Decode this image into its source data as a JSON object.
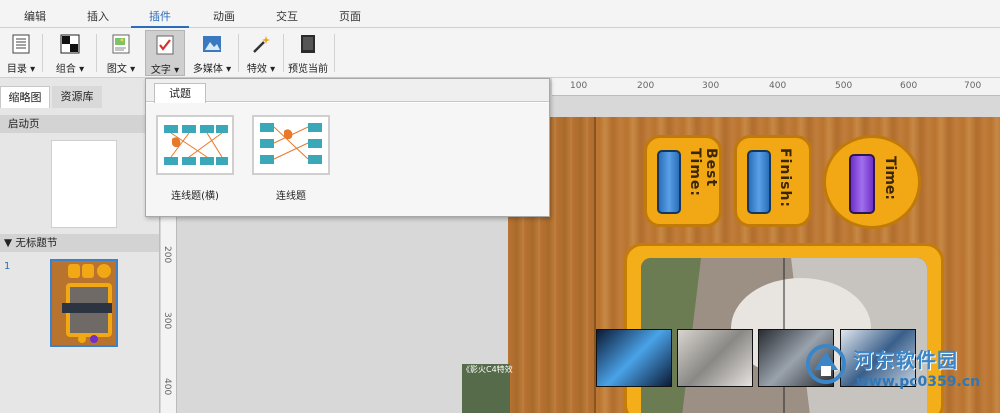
{
  "menu": {
    "tabs": [
      "编辑",
      "插入",
      "插件",
      "动画",
      "交互",
      "页面"
    ],
    "active_tab": "插件"
  },
  "toolbar": {
    "items": [
      {
        "label": "目录 ▾",
        "icon": "toc-icon"
      },
      {
        "label": "组合 ▾",
        "icon": "group-icon"
      },
      {
        "label": "图文 ▾",
        "icon": "image-text-icon"
      },
      {
        "label": "文字 ▾",
        "icon": "text-quiz-icon"
      },
      {
        "label": "多媒体 ▾",
        "icon": "multimedia-icon"
      },
      {
        "label": "特效 ▾",
        "icon": "effects-icon"
      },
      {
        "label": "预览当前",
        "icon": "preview-icon"
      }
    ]
  },
  "left_panel": {
    "tabs": [
      "缩略图",
      "资源库"
    ],
    "active_tab": "缩略图",
    "start_page_label": "启动页",
    "section_label": "▼ 无标题节",
    "slide_number": "1"
  },
  "ruler": {
    "h_ticks": [
      "100",
      "200",
      "300",
      "400",
      "500",
      "600",
      "700"
    ],
    "v_ticks": [
      "200",
      "300",
      "400"
    ]
  },
  "slide": {
    "badge_best_time": "Best Time:",
    "badge_finish": "Finish:",
    "badge_time": "Time:"
  },
  "popup": {
    "tab": "试题",
    "items": [
      {
        "label": "连线题(横)"
      },
      {
        "label": "连线题"
      }
    ]
  },
  "watermark": {
    "text": "河东软件园",
    "url": "www.pc0359.cn"
  },
  "caption": {
    "text": "《影火C4特效"
  },
  "colors": {
    "accent": "#2a6ebb",
    "badge_orange": "#f2a814",
    "wood": "#b8732f"
  }
}
